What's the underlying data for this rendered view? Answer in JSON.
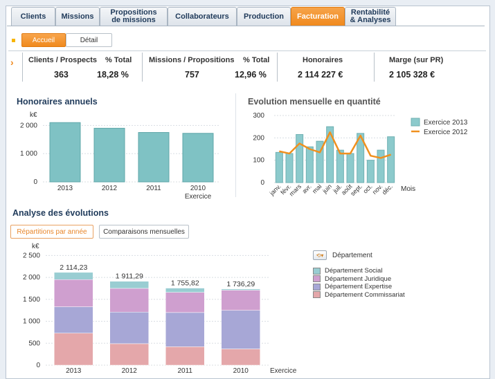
{
  "tabs": [
    {
      "label": "Clients"
    },
    {
      "label": "Missions"
    },
    {
      "label": "Propositions\nde missions"
    },
    {
      "label": "Collaborateurs"
    },
    {
      "label": "Production"
    },
    {
      "label": "Facturation"
    },
    {
      "label": "Rentabilité\n& Analyses"
    }
  ],
  "subtabs": {
    "accueil": "Accueil",
    "detail": "Détail"
  },
  "kpis": {
    "clients_label": "Clients / Prospects",
    "clients_value": "363",
    "pct1_label": "% Total",
    "pct1_value": "18,28 %",
    "missions_label": "Missions / Propositions",
    "missions_value": "757",
    "pct2_label": "% Total",
    "pct2_value": "12,96 %",
    "honoraires_label": "Honoraires",
    "honoraires_value": "2 114 227 €",
    "marge_label": "Marge (sur PR)",
    "marge_value": "2 105 328 €"
  },
  "colors": {
    "accent": "#f08a1e",
    "teal": "#7fc2c4",
    "navy": "#1f3a5a"
  },
  "sections": {
    "annual": "Honoraires annuels",
    "monthly": "Evolution mensuelle en quantité",
    "analysis": "Analyse des évolutions"
  },
  "analysis_buttons": {
    "repartitions": "Répartitions par année",
    "comparaisons": "Comparaisons mensuelles"
  },
  "chart_data": [
    {
      "type": "bar",
      "title": "Honoraires annuels",
      "ylabel": "k€",
      "xlabel": "Exercice",
      "categories": [
        "2013",
        "2012",
        "2011",
        "2010"
      ],
      "values": [
        2100,
        1900,
        1750,
        1720
      ],
      "yticks": [
        "0",
        "1 000",
        "2 000"
      ],
      "ylim": [
        0,
        2400
      ]
    },
    {
      "type": "bar",
      "title": "Evolution mensuelle en quantité",
      "xlabel": "Mois",
      "categories": [
        "janv.",
        "févr.",
        "mars",
        "avr.",
        "mai",
        "juin",
        "juil.",
        "août",
        "sept.",
        "oct.",
        "nov.",
        "déc."
      ],
      "yticks": [
        "0",
        "100",
        "200",
        "300"
      ],
      "ylim": [
        0,
        300
      ],
      "series": [
        {
          "name": "Exercice 2013",
          "values": [
            135,
            130,
            215,
            160,
            185,
            250,
            145,
            130,
            220,
            100,
            145,
            205
          ]
        },
        {
          "name": "Exercice 2012",
          "values": [
            140,
            130,
            175,
            150,
            135,
            225,
            130,
            130,
            210,
            120,
            110,
            125
          ]
        }
      ]
    },
    {
      "type": "bar",
      "stacked": true,
      "ylabel": "k€",
      "xlabel": "Exercice",
      "categories": [
        "2013",
        "2012",
        "2011",
        "2010"
      ],
      "totals": [
        "2 114,23",
        "1 911,29",
        "1 755,82",
        "1 736,29"
      ],
      "yticks": [
        "0",
        "500",
        "1 000",
        "1 500",
        "2 000",
        "2 500"
      ],
      "ylim": [
        0,
        2600
      ],
      "legend_title": "Département",
      "series": [
        {
          "name": "Département Commissariat",
          "values": [
            730,
            490,
            420,
            370
          ]
        },
        {
          "name": "Département Expertise",
          "values": [
            600,
            720,
            780,
            880
          ]
        },
        {
          "name": "Département Juridique",
          "values": [
            620,
            540,
            460,
            460
          ]
        },
        {
          "name": "Département Social",
          "values": [
            164,
            161,
            96,
            26
          ]
        }
      ]
    }
  ]
}
